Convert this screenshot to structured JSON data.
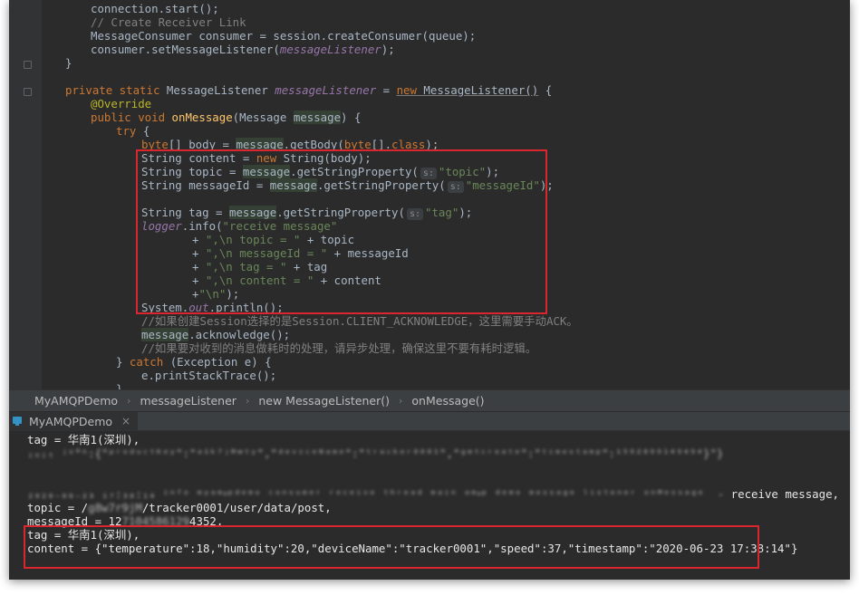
{
  "editor": {
    "l01": {
      "a": "connection.start();"
    },
    "l02": {
      "a": "// Create Receiver Link"
    },
    "l03": {
      "a": "MessageConsumer consumer = session.createConsumer(queue);"
    },
    "l04": {
      "a": "consumer.setMessageListener(",
      "b": "messageListener",
      "c": ");"
    },
    "l05": {
      "a": "}"
    },
    "l06": {
      "a": "private static",
      "b": " MessageListener ",
      "c": "messageListener",
      "d": " = ",
      "e": "new",
      "f": " MessageListener()",
      "g": " {"
    },
    "l07": {
      "a": "@Override"
    },
    "l08": {
      "a": "public void",
      "b": " ",
      "c": "onMessage",
      "d": "(Message ",
      "e": "message",
      "f": ") {"
    },
    "l09": {
      "a": "try",
      "b": " {"
    },
    "l10": {
      "a": "byte",
      "b": "[] body = ",
      "c": "message",
      "d": ".getBody(",
      "e": "byte",
      "f": "[].",
      "g": "class",
      "h": ");"
    },
    "l11": {
      "a": "String content = ",
      "b": "new",
      "c": " String(body);"
    },
    "l12": {
      "a": "String topic = ",
      "b": "message",
      "c": ".getStringProperty(",
      "hint": "s:",
      "d": "\"topic\"",
      "e": ");"
    },
    "l13": {
      "a": "String messageId = ",
      "b": "message",
      "c": ".getStringProperty(",
      "hint": "s:",
      "d": "\"messageId\"",
      "e": ");"
    },
    "l14": {
      "a": "String tag = ",
      "b": "message",
      "c": ".getStringProperty(",
      "hint": "s:",
      "d": "\"tag\"",
      "e": ");"
    },
    "l15": {
      "a": "logger",
      "b": ".info(",
      "c": "\"receive message\""
    },
    "l16": {
      "a": "+ ",
      "b": "\",\\n topic = \"",
      "c": " + topic"
    },
    "l17": {
      "a": "+ ",
      "b": "\",\\n messageId = \"",
      "c": " + messageId"
    },
    "l18": {
      "a": "+ ",
      "b": "\",\\n tag = \"",
      "c": " + tag"
    },
    "l19": {
      "a": "+ ",
      "b": "\",\\n content = \"",
      "c": " + content"
    },
    "l20": {
      "a": "+",
      "b": "\"\\n\"",
      "c": ");"
    },
    "l21": {
      "a": "System.",
      "b": "out",
      "c": ".println();"
    },
    "l22": {
      "a": "//如果创建Session选择的是Session.CLIENT_ACKNOWLEDGE，这里需要手动ACK。"
    },
    "l23": {
      "a": "message",
      "b": ".acknowledge();"
    },
    "l24": {
      "a": "//如果要对收到的消息做耗时的处理，请异步处理，确保这里不要有耗时逻辑。"
    },
    "l25": {
      "a": "} ",
      "b": "catch",
      "c": " (Exception e) {"
    },
    "l26": {
      "a": "e.printStackTrace();"
    },
    "l27": {
      "a": "}"
    }
  },
  "breadcrumbs": [
    "MyAMQPDemo",
    "messageListener",
    "new MessageListener()",
    "onMessage()"
  ],
  "run_tab": {
    "label": "MyAMQPDemo",
    "close": "×"
  },
  "console": {
    "c1": "tag = 华南1(深圳),",
    "c2": "ᵢₙᵢₜ ʲˢ°ⁿ:{\"ᵖʳᵒᵈᵘᶜᵗᴷᵉʸ\":\"ᵃ¹ᵏ⁷ʲᴹʷᵗʸ\",\"ᵈᵉᵛᶦᶜᵉᴺᵃᵐᵉ\":\"ᵗʳᵃᶜᵏᵉʳ⁰⁰⁰¹\",\"ᵍᵐᵗᶜʳᵉᵃᵗᵉ\":\"ᵗⁱᵐᵉˢᵗᵃᵐᵖ\":¹⁵⁹²⁸⁹⁹¹⁴⁹⁴⁹⁴}\"}",
    "c3": "₂₀₂₀₋₀₆₋₂₃ ₁₇:₃₈:₁₄ ⁱⁿᶠᵒ ᵐʸᵃᵐᵠᵖᵈᵉᵐᵒ ᶜᵒⁿˢᵘᵐᵉʳ ʳᵉᶜᵉⁱᵛᵉ ᵗʰʳᵉᵃᵈ ᵐᵃⁱⁿ ᵃᵐᵠᵖ ᵈᵉᵐᵒ ᵐᵉˢˢᵃᵍᵉ ˡⁱˢᵗᵉⁿᵉʳ ᵒⁿᴹᵉˢˢᵃᵍᵉ  -",
    "c3_end": " receive message,",
    "c4a": "topic = /",
    "c4b": "g8w7r9jM",
    "c4c": "/tracker0001/user/data/post,",
    "c5a": "messageId = 12",
    "c5b": "7104586129",
    "c5c": "4352,",
    "c6": "tag = 华南1(深圳),",
    "c7": "content = {\"temperature\":18,\"humidity\":20,\"deviceName\":\"tracker0001\",\"speed\":37,\"timestamp\":\"2020-06-23 17:38:14\"}"
  }
}
